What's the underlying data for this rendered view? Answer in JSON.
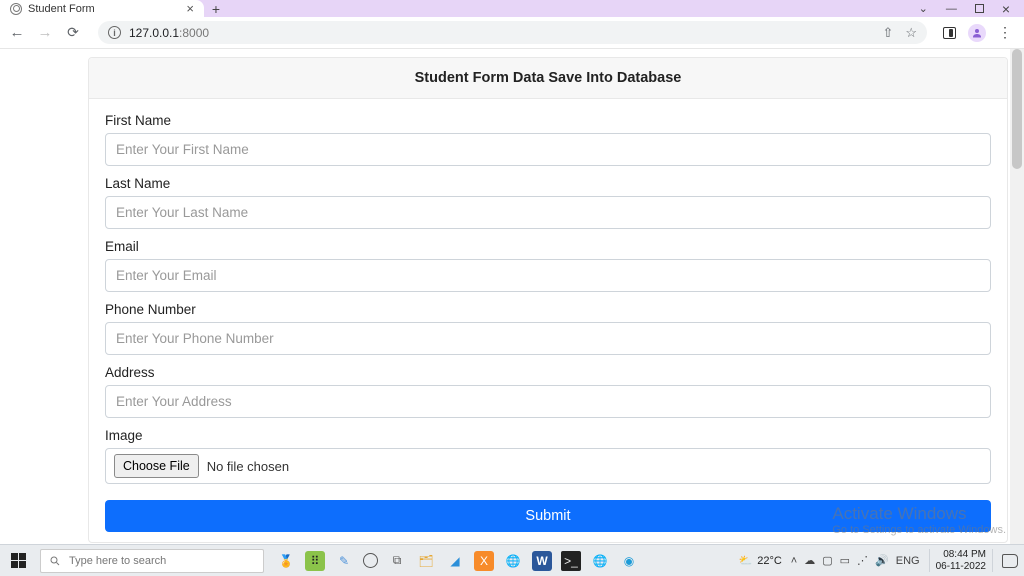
{
  "browser": {
    "tab_title": "Student Form",
    "url_host": "127.0.0.1",
    "url_port": ":8000"
  },
  "card": {
    "heading": "Student Form Data Save Into Database"
  },
  "form": {
    "first_name": {
      "label": "First Name",
      "placeholder": "Enter Your First Name",
      "value": ""
    },
    "last_name": {
      "label": "Last Name",
      "placeholder": "Enter Your Last Name",
      "value": ""
    },
    "email": {
      "label": "Email",
      "placeholder": "Enter Your Email",
      "value": ""
    },
    "phone": {
      "label": "Phone Number",
      "placeholder": "Enter Your Phone Number",
      "value": ""
    },
    "address": {
      "label": "Address",
      "placeholder": "Enter Your Address",
      "value": ""
    },
    "image": {
      "label": "Image",
      "button": "Choose File",
      "status": "No file chosen"
    },
    "submit_label": "Submit"
  },
  "watermark": {
    "title": "Activate Windows",
    "subtitle": "Go to Settings to activate Windows."
  },
  "taskbar": {
    "search_placeholder": "Type here to search",
    "weather_temp": "22°C",
    "lang": "ENG",
    "time": "08:44 PM",
    "date": "06-11-2022"
  }
}
